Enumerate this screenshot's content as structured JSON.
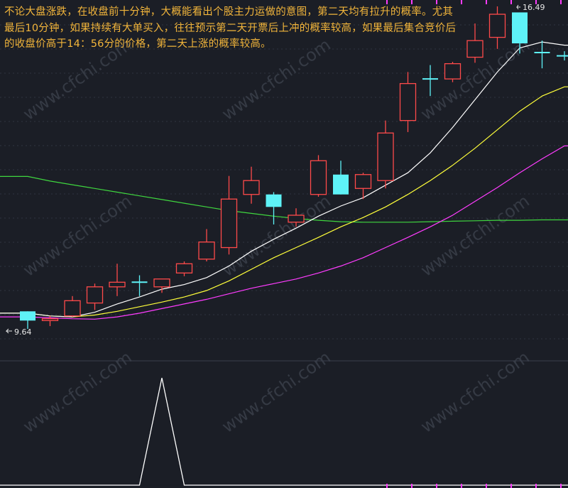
{
  "annotation": {
    "text": "不论大盘涨跌，在收盘前十分钟，大概能看出个股主力运做的意图，第二天均有拉升的概率。尤其最后10分钟，如果持续有大单买入，往往预示第二天开票后上冲的概率较高，如果最后集合竞价后的收盘价高于14：56分的价格，第二天上涨的概率较高。"
  },
  "watermark": "www.cfchi.com",
  "colors": {
    "background": "#1b1e26",
    "up_candle": "#ff4a4a",
    "down_candle": "#5ef2f7",
    "ma_white": "#ffffff",
    "ma_yellow": "#ffff3a",
    "ma_magenta": "#ff3cff",
    "ma_green": "#3fd63f",
    "annotation": "#f2b53b",
    "grid": "#2f3440",
    "label": "#e6e6e6"
  },
  "chart_data": [
    {
      "type": "candlestick",
      "labels": {
        "high": "16.49",
        "low": "9.64"
      },
      "candles": [
        {
          "o": 10.02,
          "c": 9.82,
          "h": 10.02,
          "l": 9.64
        },
        {
          "o": 9.82,
          "c": 9.86,
          "h": 9.92,
          "l": 9.7
        },
        {
          "o": 9.92,
          "c": 10.25,
          "h": 10.35,
          "l": 9.9
        },
        {
          "o": 10.2,
          "c": 10.55,
          "h": 10.62,
          "l": 10.05
        },
        {
          "o": 10.55,
          "c": 10.65,
          "h": 11.05,
          "l": 10.35
        },
        {
          "o": 10.65,
          "c": 10.65,
          "h": 10.8,
          "l": 10.35
        },
        {
          "o": 10.55,
          "c": 10.72,
          "h": 10.72,
          "l": 10.42
        },
        {
          "o": 10.85,
          "c": 11.05,
          "h": 11.1,
          "l": 10.78
        },
        {
          "o": 11.15,
          "c": 11.52,
          "h": 11.8,
          "l": 11.1
        },
        {
          "o": 11.4,
          "c": 12.45,
          "h": 12.95,
          "l": 11.25
        },
        {
          "o": 12.55,
          "c": 12.85,
          "h": 13.15,
          "l": 12.35
        },
        {
          "o": 12.55,
          "c": 12.28,
          "h": 12.6,
          "l": 11.9
        },
        {
          "o": 11.95,
          "c": 12.1,
          "h": 12.25,
          "l": 11.85
        },
        {
          "o": 12.55,
          "c": 13.28,
          "h": 13.4,
          "l": 12.5
        },
        {
          "o": 12.98,
          "c": 12.55,
          "h": 13.28,
          "l": 12.55
        },
        {
          "o": 12.68,
          "c": 12.98,
          "h": 13.02,
          "l": 12.45
        },
        {
          "o": 12.85,
          "c": 13.88,
          "h": 14.15,
          "l": 12.68
        },
        {
          "o": 14.15,
          "c": 14.95,
          "h": 15.2,
          "l": 13.9
        },
        {
          "o": 15.05,
          "c": 15.05,
          "h": 15.35,
          "l": 14.68
        },
        {
          "o": 15.05,
          "c": 15.38,
          "h": 15.42,
          "l": 14.98
        },
        {
          "o": 15.52,
          "c": 15.88,
          "h": 16.25,
          "l": 15.4
        },
        {
          "o": 15.95,
          "c": 16.45,
          "h": 16.62,
          "l": 15.7
        },
        {
          "o": 16.49,
          "c": 15.82,
          "h": 16.49,
          "l": 15.6
        },
        {
          "o": 15.62,
          "c": 15.62,
          "h": 15.88,
          "l": 15.28
        },
        {
          "o": 15.55,
          "c": 15.55,
          "h": 15.65,
          "l": 15.45
        }
      ],
      "ma_white": [
        9.98,
        9.92,
        9.9,
        10.0,
        10.18,
        10.33,
        10.5,
        10.6,
        10.75,
        11.0,
        11.32,
        11.58,
        11.82,
        12.08,
        12.3,
        12.48,
        12.75,
        13.02,
        13.45,
        14.0,
        14.6,
        15.2,
        15.72,
        15.85,
        15.78
      ],
      "ma_yellow": [
        9.98,
        9.92,
        9.9,
        9.94,
        10.02,
        10.12,
        10.22,
        10.33,
        10.47,
        10.68,
        10.93,
        11.18,
        11.4,
        11.62,
        11.85,
        12.05,
        12.28,
        12.55,
        12.85,
        13.18,
        13.55,
        13.95,
        14.35,
        14.68,
        14.88
      ],
      "ma_magenta": [
        9.9,
        9.88,
        9.86,
        9.85,
        9.9,
        9.98,
        10.08,
        10.18,
        10.28,
        10.4,
        10.52,
        10.62,
        10.72,
        10.85,
        11.0,
        11.18,
        11.4,
        11.62,
        11.85,
        12.1,
        12.4,
        12.7,
        13.02,
        13.32,
        13.6
      ],
      "ma_green": [
        12.94,
        12.84,
        12.76,
        12.68,
        12.6,
        12.52,
        12.44,
        12.36,
        12.28,
        12.2,
        12.14,
        12.08,
        12.03,
        11.99,
        11.96,
        11.95,
        11.95,
        11.95,
        11.96,
        11.97,
        11.98,
        11.99,
        11.99,
        12.0,
        12.0
      ],
      "grid": true
    },
    {
      "type": "line",
      "y": [
        0,
        0,
        0,
        0,
        0,
        0,
        1,
        0,
        0,
        0,
        0,
        0,
        0,
        0,
        0,
        0,
        0,
        0,
        0,
        0,
        0,
        0,
        0,
        0,
        0
      ]
    }
  ]
}
